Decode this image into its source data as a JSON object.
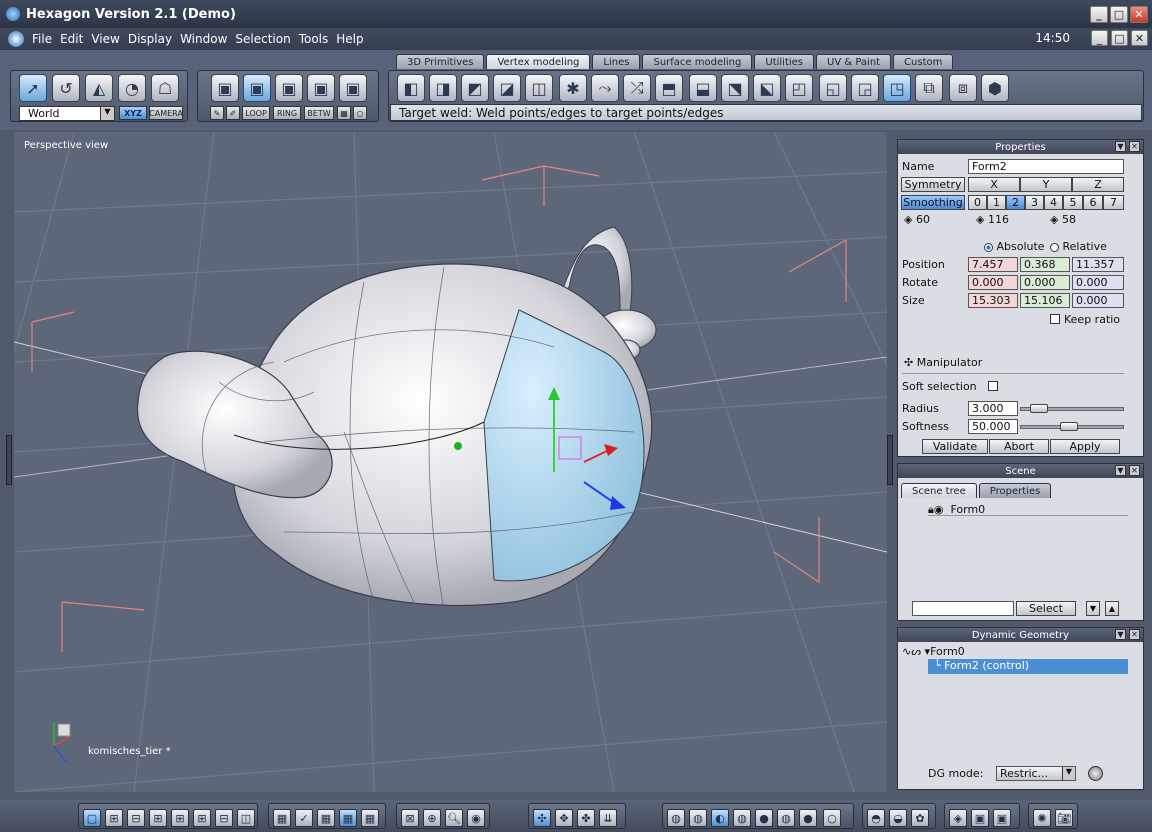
{
  "title": {
    "text": "Hexagon Version 2.1 (Demo)"
  },
  "menu": {
    "items": [
      "File",
      "Edit",
      "View",
      "Display",
      "Window",
      "Selection",
      "Tools",
      "Help"
    ],
    "clock": "14:50"
  },
  "tabs": [
    "3D Primitives",
    "Vertex modeling",
    "Lines",
    "Surface modeling",
    "Utilities",
    "UV & Paint",
    "Custom"
  ],
  "active_tab": "Vertex modeling",
  "left_tools": {
    "coord_space": "World",
    "xyz": "XYZ",
    "camera": "CAMERA",
    "loop": "LOOP",
    "ring": "RING",
    "betw": "BETW"
  },
  "status": "Target weld: Weld points/edges to target points/edges",
  "viewport": {
    "label": "Perspective view",
    "file": "komisches_tier *"
  },
  "properties": {
    "header": "Properties",
    "name_label": "Name",
    "name_value": "Form2",
    "symmetry": "Symmetry",
    "axes": [
      "X",
      "Y",
      "Z"
    ],
    "smoothing": "Smoothing",
    "levels": [
      "0",
      "1",
      "2",
      "3",
      "4",
      "5",
      "6",
      "7"
    ],
    "active_level": "2",
    "counts": [
      "60",
      "116",
      "58"
    ],
    "absolute": "Absolute",
    "relative": "Relative",
    "position_label": "Position",
    "position": [
      "7.457",
      "0.368",
      "11.357"
    ],
    "rotate_label": "Rotate",
    "rotate": [
      "0.000",
      "0.000",
      "0.000"
    ],
    "size_label": "Size",
    "size": [
      "15.303",
      "15.106",
      "0.000"
    ],
    "keep_ratio": "Keep ratio",
    "manipulator": "Manipulator",
    "soft_selection": "Soft selection",
    "radius_label": "Radius",
    "radius": "3.000",
    "radius_level": 0.1,
    "softness_label": "Softness",
    "softness": "50.000",
    "softness_level": 0.45,
    "validate": "Validate",
    "abort": "Abort",
    "apply": "Apply"
  },
  "scene": {
    "header": "Scene",
    "tabs": [
      "Scene tree",
      "Properties"
    ],
    "item": "Form0",
    "select": "Select"
  },
  "dyn": {
    "header": "Dynamic Geometry",
    "root": "Form0",
    "child": "Form2 (control)",
    "mode_label": "DG mode:",
    "mode_value": "Restric..."
  },
  "colors": {
    "selection_blue": "#a8d4ec",
    "accent": "#4d8fd6"
  }
}
